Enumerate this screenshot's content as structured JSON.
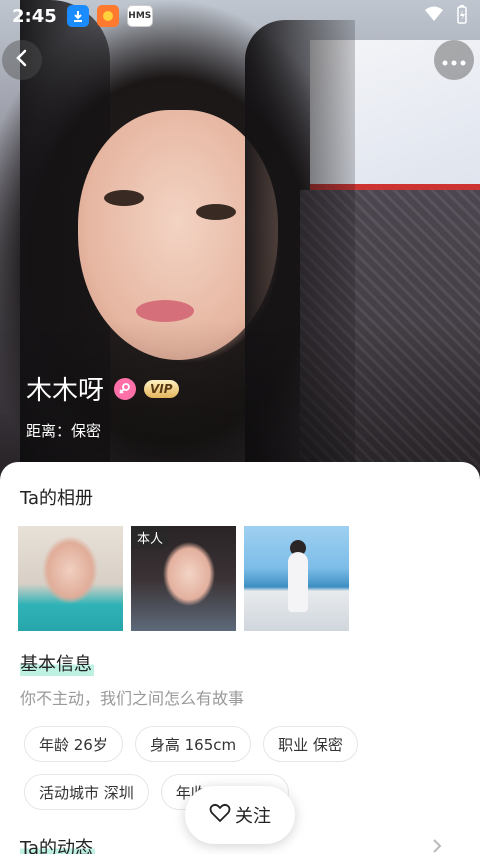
{
  "status_bar": {
    "time": "2:45",
    "hms_label": "HMS"
  },
  "nav": {
    "back_icon": "chevron-left-icon",
    "more_icon": "more-dots-icon"
  },
  "profile": {
    "name": "木木呀",
    "gender_icon": "female-icon",
    "vip_label": "VIP",
    "distance": "距离：保密"
  },
  "album": {
    "title": "Ta的相册",
    "photos": [
      {
        "tag": ""
      },
      {
        "tag": "本人"
      },
      {
        "tag": ""
      }
    ]
  },
  "basic_info": {
    "title": "基本信息",
    "motto": "你不主动，我们之间怎么有故事",
    "tags": [
      "年龄 26岁",
      "身高 165cm",
      "职业 保密",
      "活动城市 深圳",
      "年收入 5-10W"
    ]
  },
  "moments": {
    "title": "Ta的动态"
  },
  "follow": {
    "label": "关注",
    "icon": "heart-outline-icon"
  },
  "colors": {
    "gender_pink": "#ff6fa8",
    "highlight_mint": "#bff1e3",
    "vip_gold": "#e3b55b"
  }
}
